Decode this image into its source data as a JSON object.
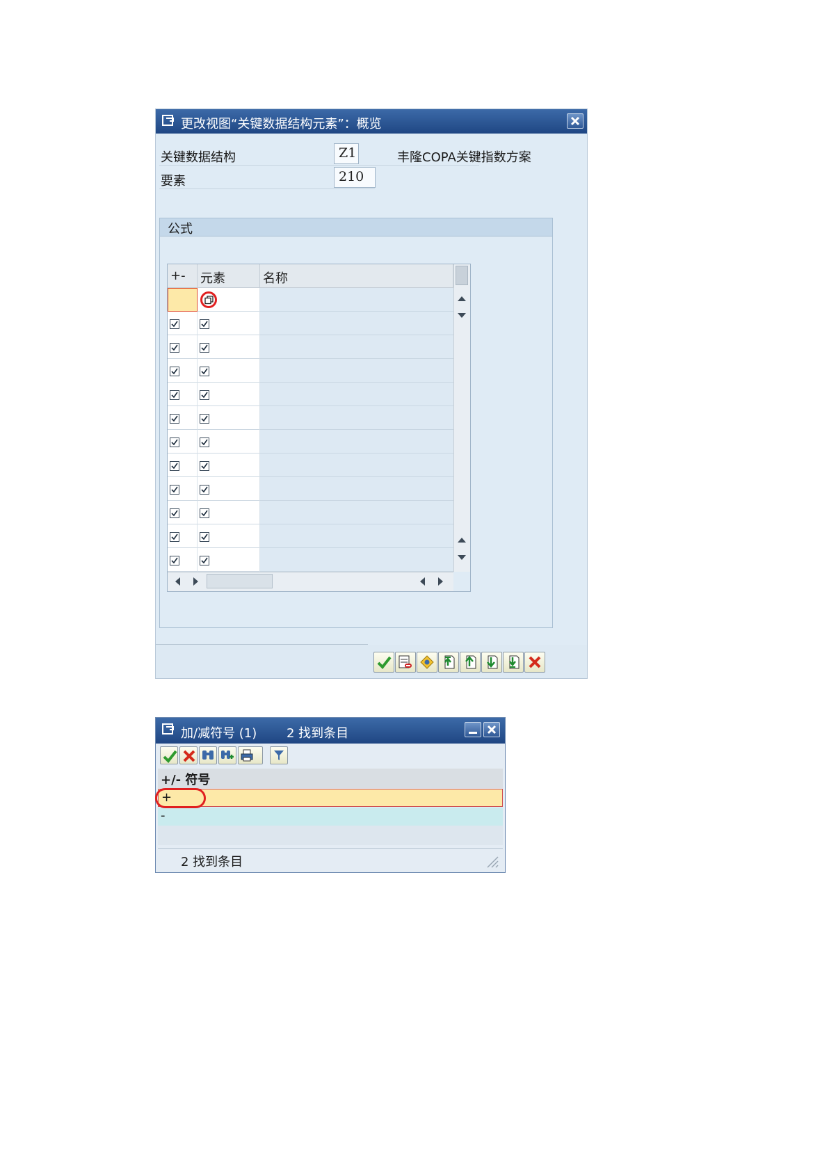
{
  "dialog1": {
    "title": "更改视图“关键数据结构元素”：概览",
    "header_fields": [
      {
        "label": "关键数据结构",
        "value": "Z1",
        "description": "丰隆COPA关键指数方案"
      },
      {
        "label": "要素",
        "value": "210"
      }
    ],
    "group_title": "公式",
    "table": {
      "columns": [
        "+-",
        "元素",
        "名称"
      ],
      "rows": [
        {
          "sign": "",
          "element": "",
          "name": "",
          "state": "input-with-copy"
        },
        {
          "sign": "checkbox-checked",
          "element": "checkbox-checked",
          "name": ""
        },
        {
          "sign": "checkbox-checked",
          "element": "checkbox-checked",
          "name": ""
        },
        {
          "sign": "checkbox-checked",
          "element": "checkbox-checked",
          "name": ""
        },
        {
          "sign": "checkbox-checked",
          "element": "checkbox-checked",
          "name": ""
        },
        {
          "sign": "checkbox-checked",
          "element": "checkbox-checked",
          "name": ""
        },
        {
          "sign": "checkbox-checked",
          "element": "checkbox-checked",
          "name": ""
        },
        {
          "sign": "checkbox-checked",
          "element": "checkbox-checked",
          "name": ""
        },
        {
          "sign": "checkbox-checked",
          "element": "checkbox-checked",
          "name": ""
        },
        {
          "sign": "checkbox-checked",
          "element": "checkbox-checked",
          "name": ""
        },
        {
          "sign": "checkbox-checked",
          "element": "checkbox-checked",
          "name": ""
        },
        {
          "sign": "checkbox-checked",
          "element": "checkbox-checked",
          "name": ""
        }
      ]
    },
    "toolbar_icons": [
      "check-icon",
      "delete-row-icon",
      "select-icon",
      "first-page-icon",
      "previous-page-icon",
      "next-page-icon",
      "last-page-icon",
      "cancel-icon"
    ]
  },
  "dialog2": {
    "title": "加/减符号 (1)",
    "title_count": "2 找到条目",
    "toolbar_icons": [
      "check-icon",
      "cancel-icon",
      "find-icon",
      "find-next-icon",
      "print-icon",
      "filter-icon"
    ],
    "column_header": "+/- 符号",
    "rows": [
      "+",
      "-"
    ],
    "status": "2 找到条目"
  },
  "colors": {
    "title_bar": "#2a5591",
    "panel": "#dfebf5",
    "selected_row": "#fde9a8",
    "alt_row": "#c9ebee",
    "highlight_circle": "#e02020"
  }
}
